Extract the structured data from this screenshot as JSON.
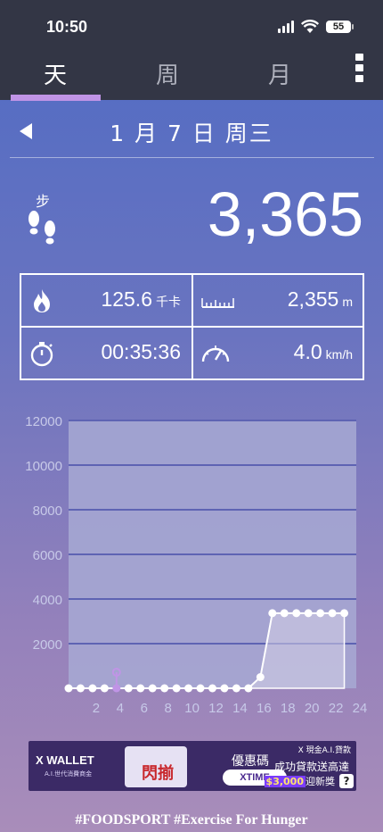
{
  "status_bar": {
    "time": "10:50",
    "battery": "55"
  },
  "tabs": [
    {
      "label": "天",
      "active": true
    },
    {
      "label": "周",
      "active": false
    },
    {
      "label": "月",
      "active": false
    }
  ],
  "date": {
    "text": "1 月 7 日 周三"
  },
  "steps": {
    "label": "步",
    "value": "3,365"
  },
  "stats": {
    "calories": {
      "value": "125.6",
      "unit": "千卡",
      "icon": "flame-icon"
    },
    "distance": {
      "value": "2,355",
      "unit": "m",
      "icon": "ruler-icon"
    },
    "duration": {
      "value": "00:35:36",
      "unit": "",
      "icon": "stopwatch-icon"
    },
    "speed": {
      "value": "4.0",
      "unit": "km/h",
      "icon": "speedometer-icon"
    }
  },
  "chart_data": {
    "type": "area",
    "x": [
      0,
      1,
      2,
      3,
      4,
      5,
      6,
      7,
      8,
      9,
      10,
      11,
      12,
      13,
      14,
      15,
      16,
      17,
      18,
      19,
      20,
      21,
      22,
      23
    ],
    "values": [
      0,
      0,
      0,
      0,
      0,
      0,
      0,
      0,
      0,
      0,
      0,
      0,
      0,
      0,
      0,
      0,
      500,
      3365,
      3365,
      3365,
      3365,
      3365,
      3365,
      3365
    ],
    "selected_index": 4,
    "xticks": [
      "2",
      "4",
      "6",
      "8",
      "10",
      "12",
      "14",
      "16",
      "18",
      "20",
      "22",
      "24"
    ],
    "xtick_values": [
      2,
      4,
      6,
      8,
      10,
      12,
      14,
      16,
      18,
      20,
      22,
      24
    ],
    "yticks": [
      "12000",
      "10000",
      "8000",
      "6000",
      "4000",
      "2000"
    ],
    "ytick_values": [
      12000,
      10000,
      8000,
      6000,
      4000,
      2000
    ],
    "ylim": [
      0,
      12000
    ],
    "xlim": [
      0,
      24
    ],
    "grid": true,
    "colors": {
      "plot_bg": "#a7a9d4",
      "line": "#ffffff",
      "fill": "#d4cfe6",
      "selected": "#c094e6",
      "grid": "#5e63b3"
    }
  },
  "ad": {
    "brand": "X WALLET",
    "brand_sub": "A.I.世代消費商金",
    "product": "閃揃",
    "code_label": "優惠碼",
    "code": "XTIME",
    "loan_title": "X 現金A.I.貸款",
    "loan_line1": "成功貸款送高達",
    "loan_amount": "$3,000",
    "loan_line2_suffix": "迎新獎",
    "help": "?"
  },
  "footer": {
    "text": "#FOODSPORT #Exercise For Hunger"
  }
}
